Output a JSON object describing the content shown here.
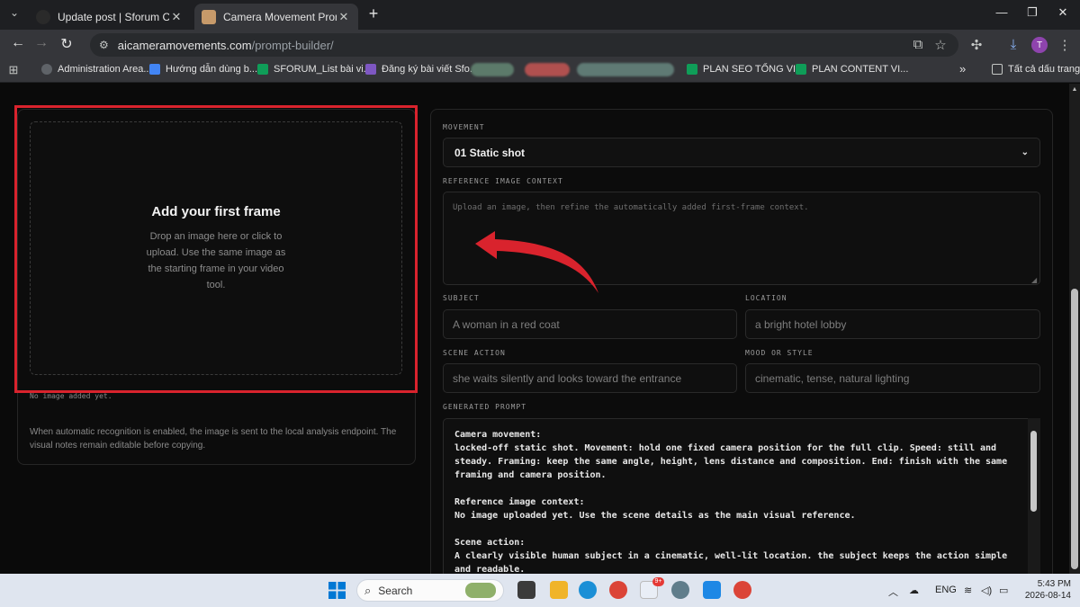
{
  "browser": {
    "tabs": [
      {
        "title": "Update post | Sforum CMS",
        "close": "✕"
      },
      {
        "title": "Camera Movement Prompt Buil",
        "close": "✕"
      }
    ],
    "new_tab": "+",
    "window_controls": {
      "minimize": "—",
      "maximize": "❐",
      "close": "✕"
    },
    "url_host": "aicameramovements.com",
    "url_path": "/prompt-builder/",
    "avatar_letter": "T"
  },
  "bookmarks": {
    "items": [
      {
        "label": "Administration Area...",
        "color": "#5f6368"
      },
      {
        "label": "Hướng dẫn dùng b...",
        "color": "#4285f4"
      },
      {
        "label": "SFORUM_List bài vi...",
        "color": "#0f9d58"
      },
      {
        "label": "Đăng ký bài viết Sfo...",
        "color": "#7e57c2"
      },
      {
        "label": "PLAN SEO TỔNG VI...",
        "color": "#0f9d58"
      },
      {
        "label": "PLAN CONTENT VI...",
        "color": "#0f9d58"
      }
    ],
    "more": "»",
    "all_bookmarks": "Tất cả dấu trang"
  },
  "left_panel": {
    "dropzone_title": "Add your first frame",
    "dropzone_text": "Drop an image here or click to upload. Use the same image as the starting frame in your video tool.",
    "status": "No image added yet.",
    "note": "When automatic recognition is enabled, the image is sent to the local analysis endpoint. The visual notes remain editable before copying."
  },
  "form": {
    "movement_label": "MOVEMENT",
    "movement_value": "01 Static shot",
    "reference_label": "REFERENCE IMAGE CONTEXT",
    "reference_placeholder": "Upload an image, then refine the automatically added first-frame context.",
    "subject_label": "SUBJECT",
    "subject_placeholder": "A woman in a red coat",
    "location_label": "LOCATION",
    "location_placeholder": "a bright hotel lobby",
    "scene_action_label": "SCENE ACTION",
    "scene_action_placeholder": "she waits silently and looks toward the entrance",
    "mood_label": "MOOD OR STYLE",
    "mood_placeholder": "cinematic, tense, natural lighting",
    "generated_label": "GENERATED PROMPT",
    "generated_prompt": [
      {
        "heading": "Camera movement:",
        "body": "locked-off static shot. Movement: hold one fixed camera position for the full clip. Speed: still and steady. Framing: keep the same angle, height, lens distance and composition. End: finish with the same framing and camera position."
      },
      {
        "heading": "Reference image context:",
        "body": "No image uploaded yet. Use the scene details as the main visual reference."
      },
      {
        "heading": "Scene action:",
        "body": "A clearly visible human subject in a cinematic, well-lit location. the subject keeps the action simple and readable."
      }
    ]
  },
  "taskbar": {
    "search_label": "Search",
    "language": "ENG",
    "time": "5:43 PM",
    "date": "2026-08-14",
    "badge": "9+"
  },
  "colors": {
    "highlight_frame": "#d9232d",
    "arrow": "#d9232d"
  }
}
